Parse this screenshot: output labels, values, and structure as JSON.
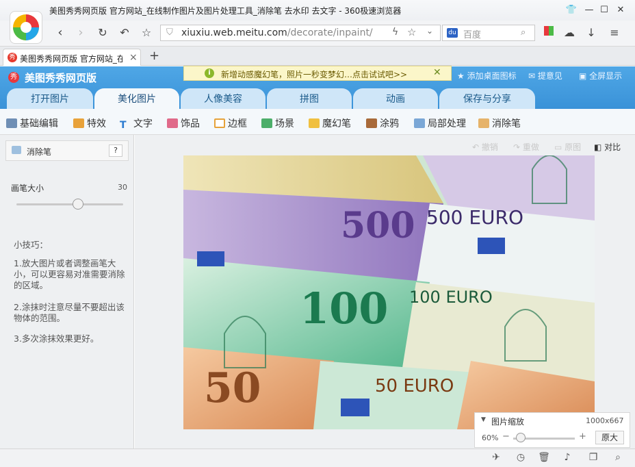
{
  "window": {
    "title": "美图秀秀网页版 官方网站_在线制作图片及图片处理工具_消除笔 去水印 去文字 - 360极速浏览器"
  },
  "nav": {
    "url_host": "xiuxiu.web.meitu.com",
    "url_path": "/decorate/inpaint/",
    "search_placeholder": "百度"
  },
  "tab": {
    "label": "美图秀秀网页版 官方网站_在线制作",
    "new_tab": "+"
  },
  "app": {
    "title": "美图秀秀网页版",
    "promo": "新增动感魔幻笔，照片一秒变梦幻…点击试试吧>>",
    "links": [
      "添加桌面图标",
      "提意见",
      "全屏显示"
    ],
    "main_tabs": [
      "打开图片",
      "美化图片",
      "人像美容",
      "拼图",
      "动画",
      "保存与分享"
    ],
    "active_tab": "美化图片",
    "tools": [
      "基础编辑",
      "特效",
      "文字",
      "饰品",
      "边框",
      "场景",
      "魔幻笔",
      "涂鸦",
      "局部处理",
      "消除笔"
    ]
  },
  "panel": {
    "title": "消除笔",
    "help": "?",
    "brush_label": "画笔大小",
    "brush_value": "30",
    "brush_fraction": 0.58,
    "tips_title": "小技巧：",
    "tips": [
      "1.放大图片或者调整画笔大小，可以更容易对准需要消除的区域。",
      "2.涂抹时注意尽量不要超出该物体的范围。",
      "3.多次涂抹效果更好。"
    ]
  },
  "history": {
    "undo": "撤销",
    "redo": "重做",
    "original": "原图",
    "compare": "对比"
  },
  "zoom": {
    "title": "图片缩放",
    "size": "1000x667",
    "percent": "60%",
    "original": "原大"
  },
  "colors": {
    "accent": "#3a92d8",
    "promo_bg": "#fbf6c9"
  }
}
